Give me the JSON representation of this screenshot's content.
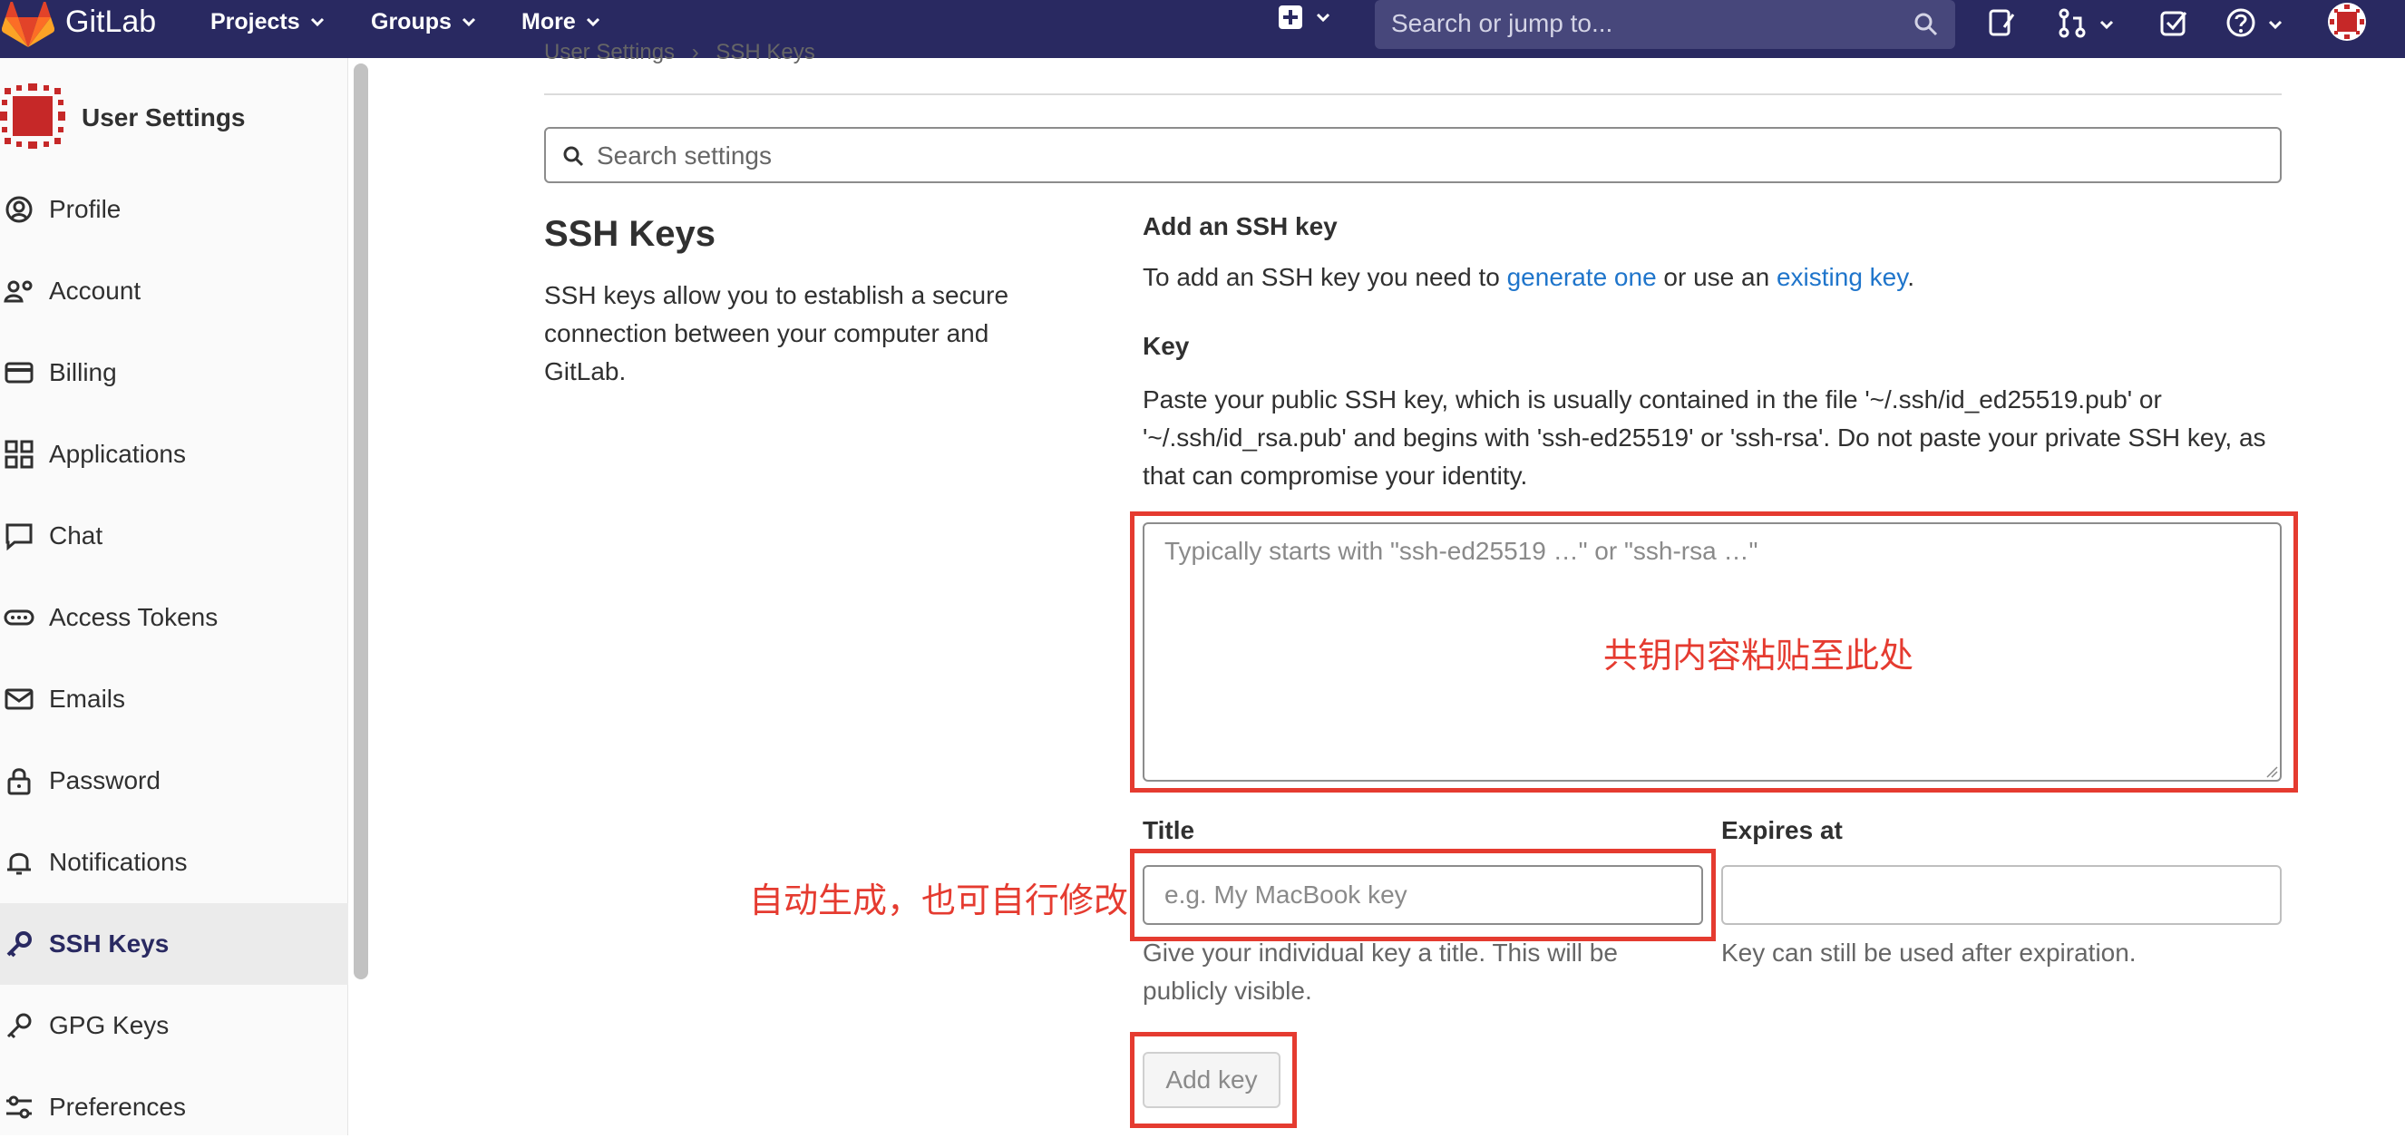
{
  "navbar": {
    "brand": "GitLab",
    "menus": [
      {
        "label": "Projects",
        "icon": "chevron-down-icon"
      },
      {
        "label": "Groups",
        "icon": "chevron-down-icon"
      },
      {
        "label": "More",
        "icon": "chevron-down-icon"
      }
    ],
    "search_placeholder": "Search or jump to...",
    "icons": [
      "plus-icon",
      "issues-icon",
      "merge-request-icon",
      "todo-icon",
      "help-icon",
      "avatar"
    ]
  },
  "sidebar": {
    "title": "User Settings",
    "items": [
      {
        "label": "Profile",
        "icon": "profile-icon"
      },
      {
        "label": "Account",
        "icon": "account-icon"
      },
      {
        "label": "Billing",
        "icon": "billing-icon"
      },
      {
        "label": "Applications",
        "icon": "applications-icon"
      },
      {
        "label": "Chat",
        "icon": "chat-icon"
      },
      {
        "label": "Access Tokens",
        "icon": "token-icon"
      },
      {
        "label": "Emails",
        "icon": "mail-icon"
      },
      {
        "label": "Password",
        "icon": "lock-icon"
      },
      {
        "label": "Notifications",
        "icon": "bell-icon"
      },
      {
        "label": "SSH Keys",
        "icon": "key-icon",
        "active": true
      },
      {
        "label": "GPG Keys",
        "icon": "key-icon"
      },
      {
        "label": "Preferences",
        "icon": "preferences-icon"
      }
    ]
  },
  "breadcrumb": {
    "parent": "User Settings",
    "separator": "›",
    "current": "SSH Keys"
  },
  "settings_search": {
    "placeholder": "Search settings"
  },
  "section": {
    "title": "SSH Keys",
    "description": "SSH keys allow you to establish a secure connection between your computer and GitLab."
  },
  "form": {
    "heading": "Add an SSH key",
    "intro_prefix": "To add an SSH key you need to ",
    "intro_link1": "generate one",
    "intro_middle": " or use an ",
    "intro_link2": "existing key",
    "intro_suffix": ".",
    "key_label": "Key",
    "key_help": "Paste your public SSH key, which is usually contained in the file '~/.ssh/id_ed25519.pub' or '~/.ssh/id_rsa.pub' and begins with 'ssh-ed25519' or 'ssh-rsa'. Do not paste your private SSH key, as that can compromise your identity.",
    "key_placeholder": "Typically starts with \"ssh-ed25519 …\" or \"ssh-rsa …\"",
    "title_label": "Title",
    "title_placeholder": "e.g. My MacBook key",
    "title_hint": "Give your individual key a title. This will be publicly visible.",
    "expires_label": "Expires at",
    "expires_hint": "Key can still be used after expiration.",
    "submit_label": "Add key"
  },
  "annotations": {
    "key_note": "共钥内容粘贴至此处",
    "title_note": "自动生成，也可自行修改",
    "color": "#e53b30"
  },
  "colors": {
    "navbar": "#292961",
    "link": "#1f75cb",
    "active_item": "#292961"
  }
}
